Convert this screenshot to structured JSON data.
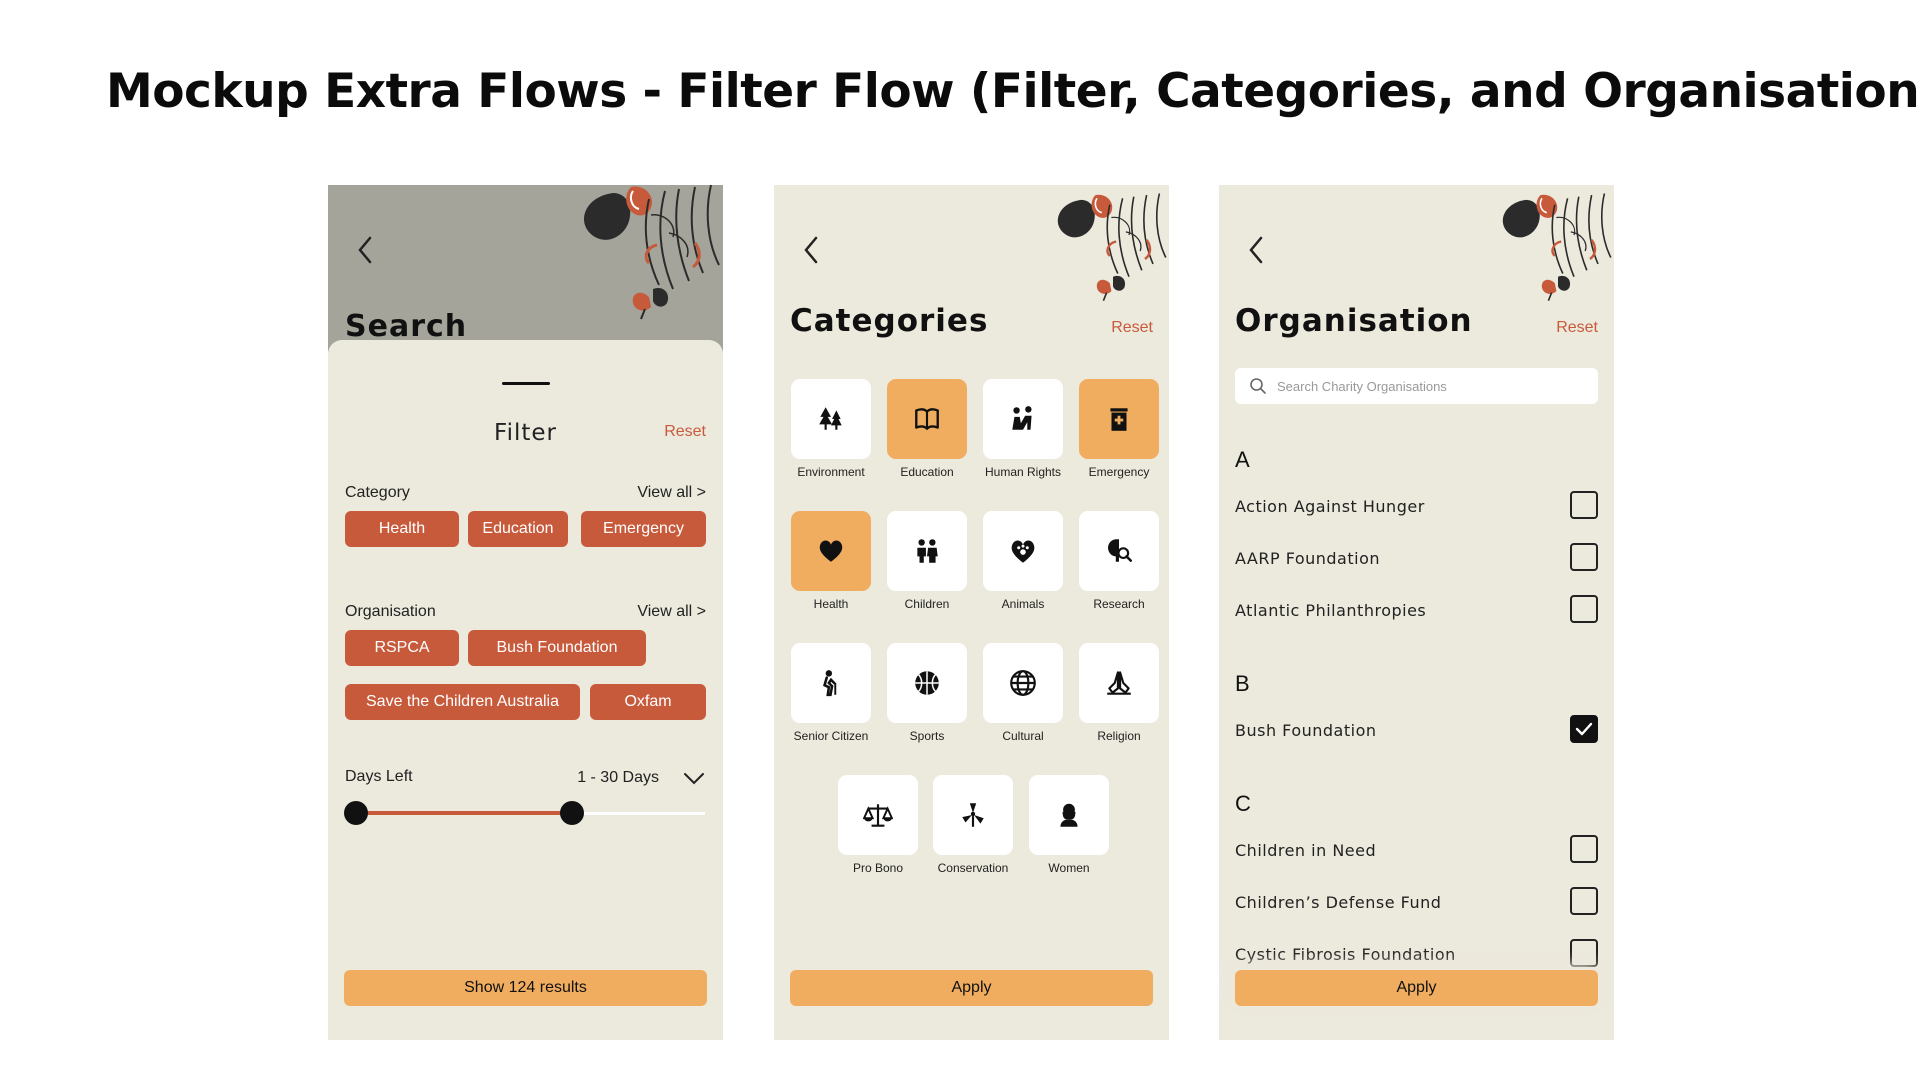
{
  "page_title": "Mockup Extra Flows - Filter Flow (Filter, Categories, and Organisation)",
  "colors": {
    "accent": "#c85a3c",
    "button": "#f0ad60",
    "background": "#ece9dd",
    "header_grey": "#a4a49b"
  },
  "filter_screen": {
    "search_heading": "Search",
    "sheet_title": "Filter",
    "reset": "Reset",
    "category": {
      "label": "Category",
      "view_all": "View all >",
      "chips": [
        "Health",
        "Education",
        "Emergency"
      ]
    },
    "organisation": {
      "label": "Organisation",
      "view_all": "View all >",
      "chips": [
        "RSPCA",
        "Bush Foundation",
        "Save the Children Australia",
        "Oxfam"
      ]
    },
    "days_left": {
      "label": "Days Left",
      "value": "1 - 30 Days",
      "range_min_fraction": 0.0,
      "range_max_fraction": 0.62
    },
    "show_button": "Show 124 results"
  },
  "categories_screen": {
    "heading": "Categories",
    "reset": "Reset",
    "items": [
      {
        "label": "Environment",
        "icon": "trees-icon",
        "selected": false
      },
      {
        "label": "Education",
        "icon": "book-icon",
        "selected": true
      },
      {
        "label": "Human Rights",
        "icon": "people-icon",
        "selected": false
      },
      {
        "label": "Emergency",
        "icon": "hospital-icon",
        "selected": true
      },
      {
        "label": "Health",
        "icon": "heart-icon",
        "selected": true
      },
      {
        "label": "Children",
        "icon": "children-icon",
        "selected": false
      },
      {
        "label": "Animals",
        "icon": "paw-heart-icon",
        "selected": false
      },
      {
        "label": "Research",
        "icon": "brain-search-icon",
        "selected": false
      },
      {
        "label": "Senior Citizen",
        "icon": "elderly-icon",
        "selected": false
      },
      {
        "label": "Sports",
        "icon": "basketball-icon",
        "selected": false
      },
      {
        "label": "Cultural",
        "icon": "globe-icon",
        "selected": false
      },
      {
        "label": "Religion",
        "icon": "praying-hands-icon",
        "selected": false
      },
      {
        "label": "Pro Bono",
        "icon": "scales-icon",
        "selected": false
      },
      {
        "label": "Conservation",
        "icon": "windmill-icon",
        "selected": false
      },
      {
        "label": "Women",
        "icon": "woman-icon",
        "selected": false
      }
    ],
    "apply": "Apply"
  },
  "organisation_screen": {
    "heading": "Organisation",
    "reset": "Reset",
    "search_placeholder": "Search Charity Organisations",
    "groups": [
      {
        "letter": "A",
        "items": [
          {
            "name": "Action Against Hunger",
            "checked": false
          },
          {
            "name": "AARP Foundation",
            "checked": false
          },
          {
            "name": "Atlantic Philanthropies",
            "checked": false
          }
        ]
      },
      {
        "letter": "B",
        "items": [
          {
            "name": "Bush Foundation",
            "checked": true
          }
        ]
      },
      {
        "letter": "C",
        "items": [
          {
            "name": "Children in Need",
            "checked": false
          },
          {
            "name": "Children’s Defense Fund",
            "checked": false
          },
          {
            "name": "Cystic Fibrosis Foundation",
            "checked": false
          }
        ]
      }
    ],
    "apply": "Apply"
  }
}
